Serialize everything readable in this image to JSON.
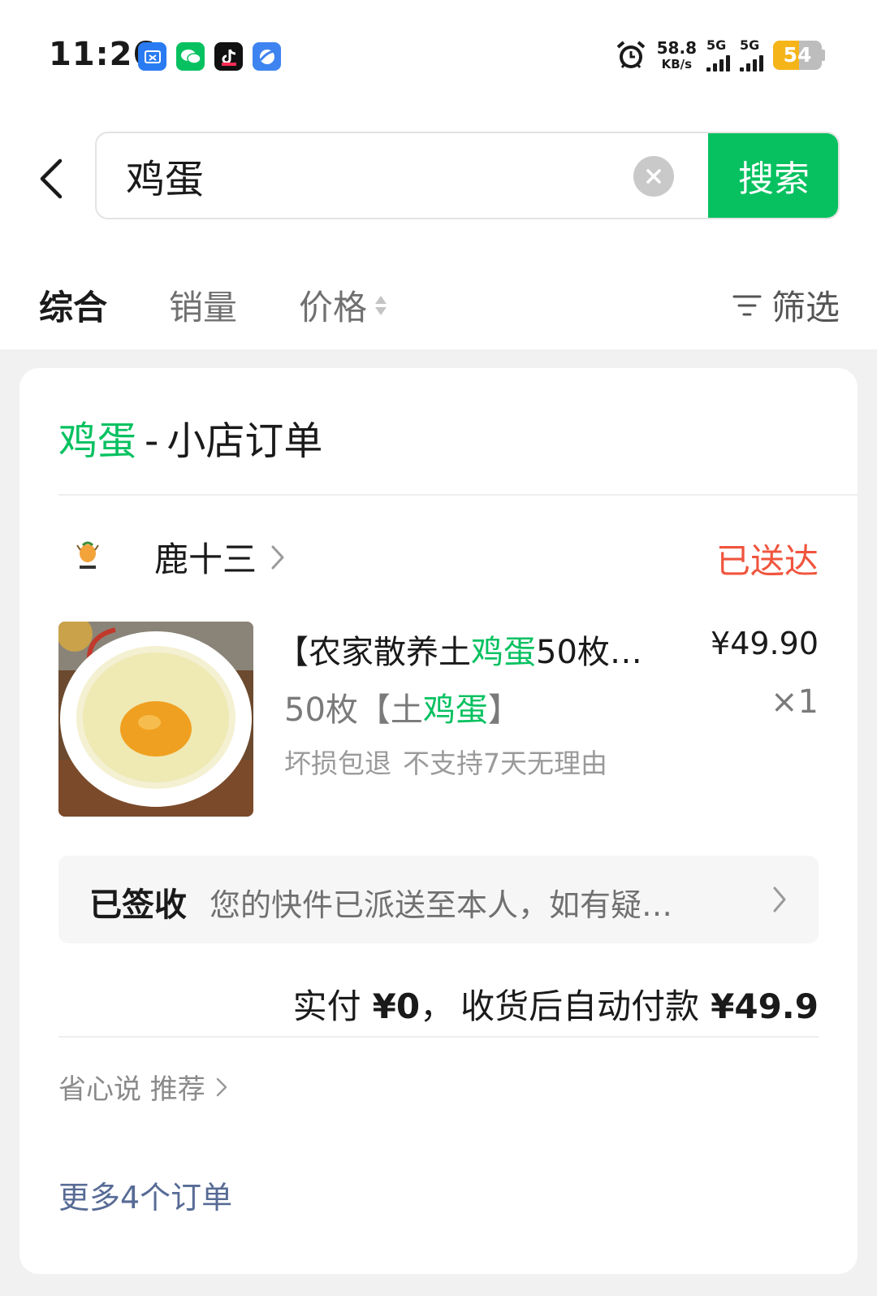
{
  "status_bar": {
    "time": "11:26",
    "net_speed_value": "58.8",
    "net_speed_unit": "KB/s",
    "sim1_tag": "5G",
    "sim2_tag": "5G",
    "battery_level": "54"
  },
  "search": {
    "query": "鸡蛋",
    "button_label": "搜索"
  },
  "sort_tabs": {
    "comprehensive": "综合",
    "sales": "销量",
    "price": "价格",
    "filter": "筛选"
  },
  "card": {
    "title_keyword": "鸡蛋",
    "title_separator": "-",
    "title_rest": "小店订单"
  },
  "order": {
    "shop_name": "鹿十三",
    "status": "已送达",
    "product_title_prefix": "【农家散养土",
    "product_title_keyword": "鸡蛋",
    "product_title_suffix": "50枚…",
    "price": "¥49.90",
    "spec_prefix": "50枚【土",
    "spec_keyword": "鸡蛋",
    "spec_suffix": "】",
    "quantity": "×1",
    "tags": [
      "坏损包退",
      "不支持7天无理由"
    ],
    "logistics_status": "已签收",
    "logistics_text": "您的快件已派送至本人，如有疑…",
    "pay_label": "实付",
    "pay_amount": "¥0",
    "pay_separator": "，",
    "auto_pay_label": "收货后自动付款",
    "auto_pay_amount": "¥49.9"
  },
  "recommend_label": "省心说 推荐",
  "more_orders": "更多4个订单",
  "colors": {
    "accent_green": "#07c160",
    "status_red": "#f0553d",
    "link_blue": "#576b95",
    "battery_yellow": "#f5b519"
  }
}
